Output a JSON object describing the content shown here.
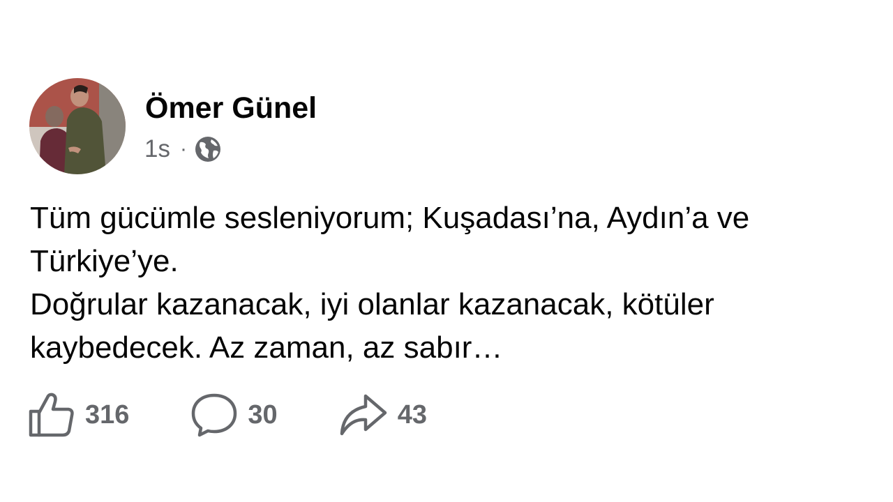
{
  "post": {
    "author": "Ömer Günel",
    "timestamp": "1s",
    "separator": "·",
    "privacy_icon": "globe-icon",
    "paragraphs": [
      "Tüm gücümle sesleniyorum; Kuşadası’na, Aydın’a ve Türkiye’ye.",
      "Doğrular kazanacak, iyi olanlar kazanacak, kötüler kaybedecek. Az zaman, az sabır…"
    ]
  },
  "actions": {
    "like": {
      "icon": "thumbs-up-icon",
      "count": "316"
    },
    "comment": {
      "icon": "comment-bubble-icon",
      "count": "30"
    },
    "share": {
      "icon": "share-arrow-icon",
      "count": "43"
    }
  },
  "colors": {
    "text_primary": "#050505",
    "text_secondary": "#65676b",
    "background": "#ffffff"
  }
}
